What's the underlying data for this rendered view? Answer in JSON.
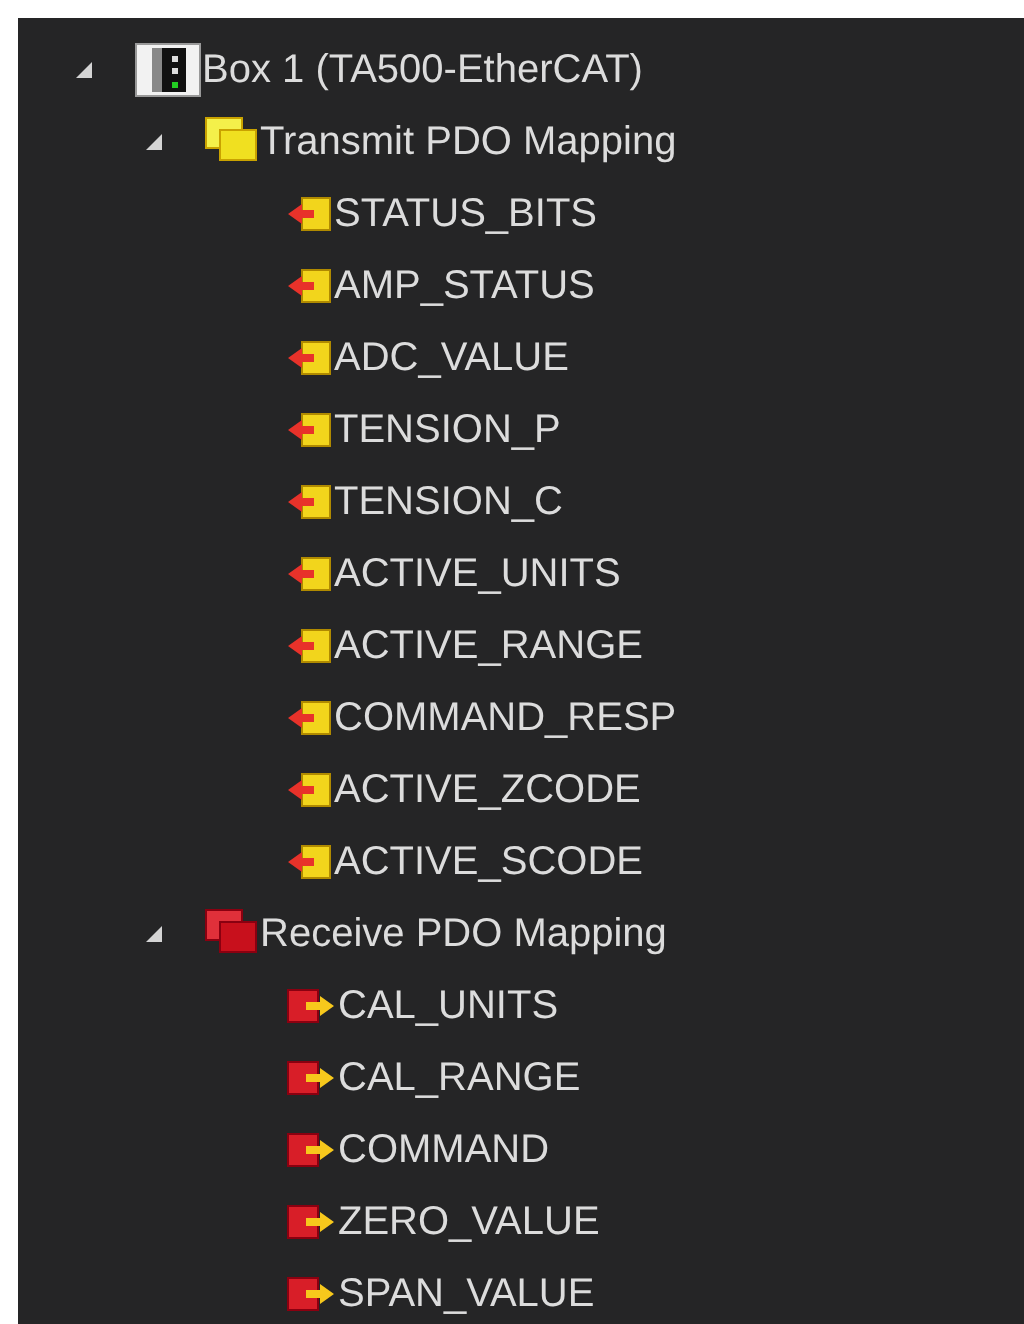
{
  "tree": [
    {
      "label": "Box 1 (TA500-EtherCAT)",
      "kind": "device",
      "expanded": true,
      "children": [
        {
          "label": "Transmit PDO Mapping",
          "kind": "transmit",
          "expanded": true,
          "children": [
            {
              "label": "STATUS_BITS",
              "kind": "input"
            },
            {
              "label": "AMP_STATUS",
              "kind": "input"
            },
            {
              "label": "ADC_VALUE",
              "kind": "input"
            },
            {
              "label": "TENSION_P",
              "kind": "input"
            },
            {
              "label": "TENSION_C",
              "kind": "input"
            },
            {
              "label": "ACTIVE_UNITS",
              "kind": "input"
            },
            {
              "label": "ACTIVE_RANGE",
              "kind": "input"
            },
            {
              "label": "COMMAND_RESP",
              "kind": "input"
            },
            {
              "label": "ACTIVE_ZCODE",
              "kind": "input"
            },
            {
              "label": "ACTIVE_SCODE",
              "kind": "input"
            }
          ]
        },
        {
          "label": "Receive PDO Mapping",
          "kind": "receive",
          "expanded": true,
          "children": [
            {
              "label": "CAL_UNITS",
              "kind": "output"
            },
            {
              "label": "CAL_RANGE",
              "kind": "output"
            },
            {
              "label": "COMMAND",
              "kind": "output"
            },
            {
              "label": "ZERO_VALUE",
              "kind": "output"
            },
            {
              "label": "SPAN_VALUE",
              "kind": "output"
            }
          ]
        }
      ]
    }
  ]
}
